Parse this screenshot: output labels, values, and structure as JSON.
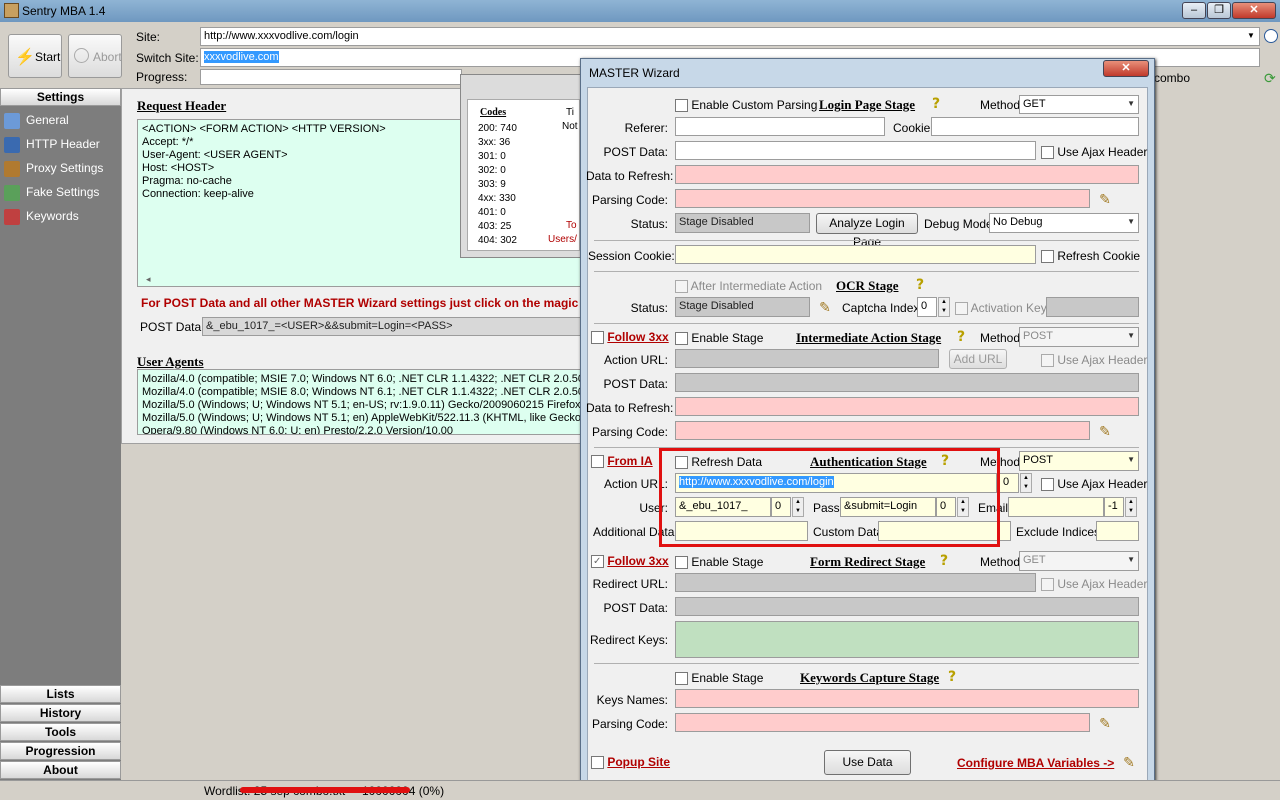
{
  "window": {
    "title": "Sentry MBA 1.4"
  },
  "top": {
    "start_label": "Start",
    "abort_label": "Abort",
    "site_label": "Site:",
    "site_value": "http://www.xxxvodlive.com/login",
    "switch_site_label": "Switch Site:",
    "switch_site_value": "xxxvodlive.com",
    "progress_label": "Progress:",
    "combo_label": "combo"
  },
  "sidebar": {
    "settings_label": "Settings",
    "items": [
      {
        "label": "General",
        "icon": "general-icon"
      },
      {
        "label": "HTTP Header",
        "icon": "http-header-icon"
      },
      {
        "label": "Proxy Settings",
        "icon": "proxy-icon"
      },
      {
        "label": "Fake Settings",
        "icon": "fake-icon"
      },
      {
        "label": "Keywords",
        "icon": "keywords-icon"
      }
    ],
    "bottom": [
      "Lists",
      "History",
      "Tools",
      "Progression",
      "About"
    ]
  },
  "main": {
    "request_header_title": "Request Header",
    "request_header_text": "<ACTION> <FORM ACTION> <HTTP VERSION>\nAccept: */*\nUser-Agent: <USER AGENT>\nHost: <HOST>\nPragma: no-cache\nConnection: keep-alive",
    "post_notice": "For POST Data and all other MASTER Wizard settings just click on the magic",
    "post_data_label": "POST Data:",
    "post_data_value": "&_ebu_1017_=<USER>&&submit=Login=<PASS>",
    "user_agents_title": "User Agents",
    "user_agents": [
      "Mozilla/4.0 (compatible; MSIE 7.0; Windows NT 6.0; .NET CLR 1.1.4322; .NET CLR 2.0.507",
      "Mozilla/4.0 (compatible; MSIE 8.0; Windows NT 6.1; .NET CLR 1.1.4322; .NET CLR 2.0.507",
      "Mozilla/5.0 (Windows; U; Windows NT 5.1; en-US; rv:1.9.0.11) Gecko/2009060215 Firefox/",
      "Mozilla/5.0 (Windows; U; Windows NT 5.1; en) AppleWebKit/522.11.3 (KHTML, like Gecko)",
      "Opera/9.80 (Windows NT 6.0; U; en) Presto/2.2.0 Version/10.00"
    ]
  },
  "stats": {
    "codes_title": "Codes",
    "rows": [
      {
        "code": "200:",
        "value": "740"
      },
      {
        "code": "3xx:",
        "value": "36"
      },
      {
        "code": "301:",
        "value": "0"
      },
      {
        "code": "302:",
        "value": "0"
      },
      {
        "code": "303:",
        "value": "9"
      },
      {
        "code": "4xx:",
        "value": "330"
      },
      {
        "code": "401:",
        "value": "0"
      },
      {
        "code": "403:",
        "value": "25"
      },
      {
        "code": "404:",
        "value": "302"
      }
    ],
    "col2_head": "Ti",
    "col2_not": "Not",
    "col2_to": "To",
    "col2_users": "Users/"
  },
  "wizard": {
    "title": "MASTER Wizard",
    "close": "✕",
    "login": {
      "custom_parsing": "Enable Custom Parsing",
      "stage": "Login Page Stage",
      "method_label": "Method:",
      "method": "GET",
      "referer_label": "Referer:",
      "cookie_label": "Cookie:",
      "post_data_label": "POST Data:",
      "use_ajax": "Use Ajax Header",
      "data_refresh_label": "Data to Refresh:",
      "parsing_code_label": "Parsing Code:",
      "status_label": "Status:",
      "status": "Stage Disabled",
      "analyze_btn": "Analyze Login Page",
      "debug_label": "Debug Mode:",
      "debug": "No Debug",
      "session_cookie_label": "Session Cookie:",
      "refresh_cookie": "Refresh Cookie"
    },
    "ocr": {
      "after_ia": "After Intermediate Action",
      "stage": "OCR Stage",
      "status_label": "Status:",
      "status": "Stage Disabled",
      "captcha_label": "Captcha Index:",
      "captcha_value": "0",
      "activation_key": "Activation Key:"
    },
    "ia": {
      "follow": "Follow 3xx",
      "enable": "Enable Stage",
      "stage": "Intermediate Action Stage",
      "method_label": "Method:",
      "method": "POST",
      "action_url_label": "Action URL:",
      "add_url": "Add URL",
      "use_ajax": "Use Ajax Header",
      "post_data_label": "POST Data:",
      "data_refresh_label": "Data to Refresh:",
      "parsing_code_label": "Parsing Code:"
    },
    "auth": {
      "from_ia": "From IA",
      "refresh_data": "Refresh Data",
      "stage": "Authentication Stage",
      "method_label": "Method:",
      "method": "POST",
      "action_url_label": "Action URL:",
      "action_url": "http://www.xxxvodlive.com/login",
      "action_index": "0",
      "use_ajax": "Use Ajax Header",
      "user_label": "User:",
      "user_value": "&_ebu_1017_",
      "user_index": "0",
      "pass_label": "Pass:",
      "pass_value": "&submit=Login",
      "pass_index": "0",
      "email_label": "Email:",
      "email_index": "-1",
      "additional_label": "Additional Data:",
      "custom_label": "Custom Data:",
      "exclude_label": "Exclude Indices:"
    },
    "redirect": {
      "follow": "Follow 3xx",
      "enable": "Enable Stage",
      "stage": "Form Redirect Stage",
      "method_label": "Method:",
      "method": "GET",
      "redirect_url_label": "Redirect URL:",
      "use_ajax": "Use Ajax Header",
      "post_data_label": "POST Data:",
      "redirect_keys_label": "Redirect Keys:"
    },
    "keywords": {
      "enable": "Enable Stage",
      "stage": "Keywords Capture Stage",
      "keys_names_label": "Keys Names:",
      "parsing_code_label": "Parsing Code:"
    },
    "footer": {
      "popup_site": "Popup Site",
      "use_data": "Use Data",
      "configure": "Configure MBA Variables ->"
    }
  },
  "status": {
    "wordlist": "Wordlist: 25 sep combo.txt",
    "progress": "10000004 (0%)"
  },
  "colors": {
    "highlight_box": "#e01010",
    "stage_link": "#b00000",
    "pink_field": "#ffcccc",
    "yellow_field": "#ffffe1"
  }
}
